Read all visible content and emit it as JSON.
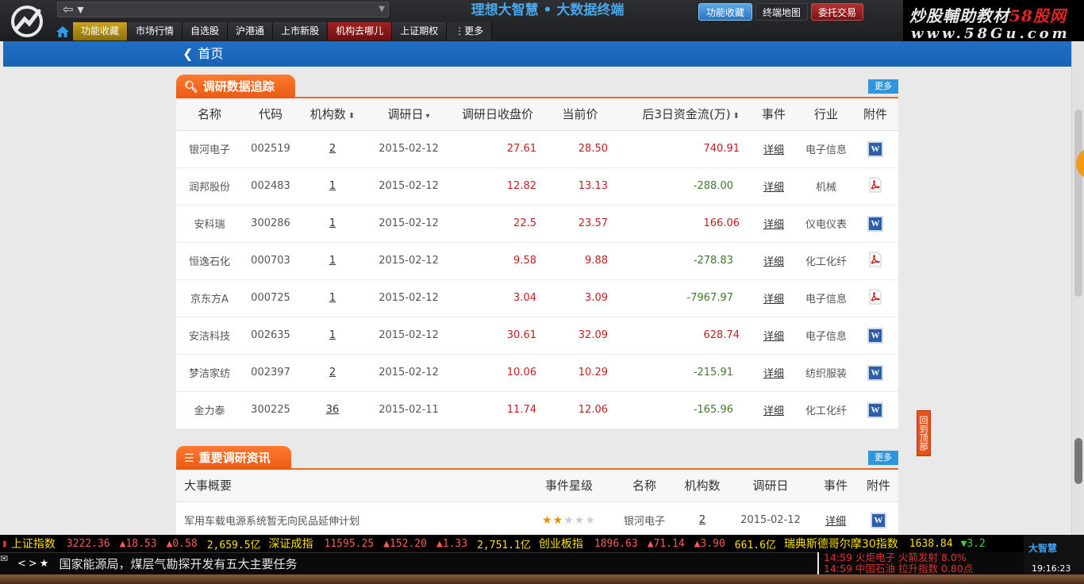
{
  "app": {
    "title": "理想大智慧 • 大数据终端",
    "buttons": {
      "favorites": "功能收藏",
      "terminal_map": "终端地图",
      "trade": "委托交易"
    }
  },
  "watermark": {
    "line1_a": "炒股輔助教材",
    "line1_b": "58股网",
    "line2": "www.58Gu.com"
  },
  "nav": {
    "items": [
      "功能收藏",
      "市场行情",
      "自选股",
      "沪港通",
      "上市新股",
      "机构去哪儿",
      "上证期权"
    ],
    "more": "更多"
  },
  "breadcrumb": {
    "back_label": "首页"
  },
  "research": {
    "title": "调研数据追踪",
    "more": "更多",
    "columns": [
      "名称",
      "代码",
      "机构数",
      "调研日",
      "调研日收盘价",
      "当前价",
      "后3日资金流(万)",
      "事件",
      "行业",
      "附件"
    ],
    "rows": [
      {
        "name": "银河电子",
        "code": "002519",
        "inst": "2",
        "date": "2015-02-12",
        "close": "27.61",
        "price": "28.50",
        "flow": "740.91",
        "event": "详细",
        "industry": "电子信息",
        "attach": "word"
      },
      {
        "name": "润邦股份",
        "code": "002483",
        "inst": "1",
        "date": "2015-02-12",
        "close": "12.82",
        "price": "13.13",
        "flow": "-288.00",
        "event": "详细",
        "industry": "机械",
        "attach": "pdf"
      },
      {
        "name": "安科瑞",
        "code": "300286",
        "inst": "1",
        "date": "2015-02-12",
        "close": "22.5",
        "price": "23.57",
        "flow": "166.06",
        "event": "详细",
        "industry": "仪电仪表",
        "attach": "word"
      },
      {
        "name": "恒逸石化",
        "code": "000703",
        "inst": "1",
        "date": "2015-02-12",
        "close": "9.58",
        "price": "9.88",
        "flow": "-278.83",
        "event": "详细",
        "industry": "化工化纤",
        "attach": "pdf"
      },
      {
        "name": "京东方A",
        "code": "000725",
        "inst": "1",
        "date": "2015-02-12",
        "close": "3.04",
        "price": "3.09",
        "flow": "-7967.97",
        "event": "详细",
        "industry": "电子信息",
        "attach": "pdf"
      },
      {
        "name": "安洁科技",
        "code": "002635",
        "inst": "1",
        "date": "2015-02-12",
        "close": "30.61",
        "price": "32.09",
        "flow": "628.74",
        "event": "详细",
        "industry": "电子信息",
        "attach": "word"
      },
      {
        "name": "梦洁家纺",
        "code": "002397",
        "inst": "2",
        "date": "2015-02-12",
        "close": "10.06",
        "price": "10.29",
        "flow": "-215.91",
        "event": "详细",
        "industry": "纺织服装",
        "attach": "word"
      },
      {
        "name": "金力泰",
        "code": "300225",
        "inst": "36",
        "date": "2015-02-11",
        "close": "11.74",
        "price": "12.06",
        "flow": "-165.96",
        "event": "详细",
        "industry": "化工化纤",
        "attach": "word"
      }
    ]
  },
  "news_section": {
    "title": "重要调研资讯",
    "more": "更多",
    "columns": [
      "大事概要",
      "事件星级",
      "名称",
      "机构数",
      "调研日",
      "事件",
      "附件"
    ],
    "rows": [
      {
        "summary": "军用车载电源系统暂无向民品延伸计划",
        "stars": 2,
        "max_stars": 5,
        "name": "银河电子",
        "inst": "2",
        "date": "2015-02-12",
        "event": "详细",
        "attach": "word"
      }
    ]
  },
  "back_to_top": "回到顶部",
  "ticker": [
    {
      "name": "上证指数",
      "value": "3222.36",
      "change": "▲18.53",
      "pct": "▲0.58",
      "amount": "2,659.5亿"
    },
    {
      "name": "深证成指",
      "value": "11595.25",
      "change": "▲152.20",
      "pct": "▲1.33",
      "amount": "2,751.1亿"
    },
    {
      "name": "创业板指",
      "value": "1896.63",
      "change": "▲71.14",
      "pct": "▲3.90",
      "amount": "661.6亿"
    },
    {
      "name": "瑞典斯德哥尔摩30指数",
      "value": "1638.84",
      "change": "▼3.2",
      "pct": "",
      "amount": ""
    }
  ],
  "news_ticker": "国家能源局，煤层气勘探开发有五大主要任务",
  "news_controls": "<>★",
  "alerts": [
    "14:59 火炬电子 火箭发射 8.0%",
    "14:59 中国石油 拉升指数 0.80点"
  ],
  "brand": {
    "name": "大智慧",
    "time": "19:16:23"
  },
  "colors": {
    "accent_orange": "#ef6420",
    "blue_bar": "#1e6fc6",
    "up_red": "#c22020",
    "down_green": "#3f7a2b"
  }
}
